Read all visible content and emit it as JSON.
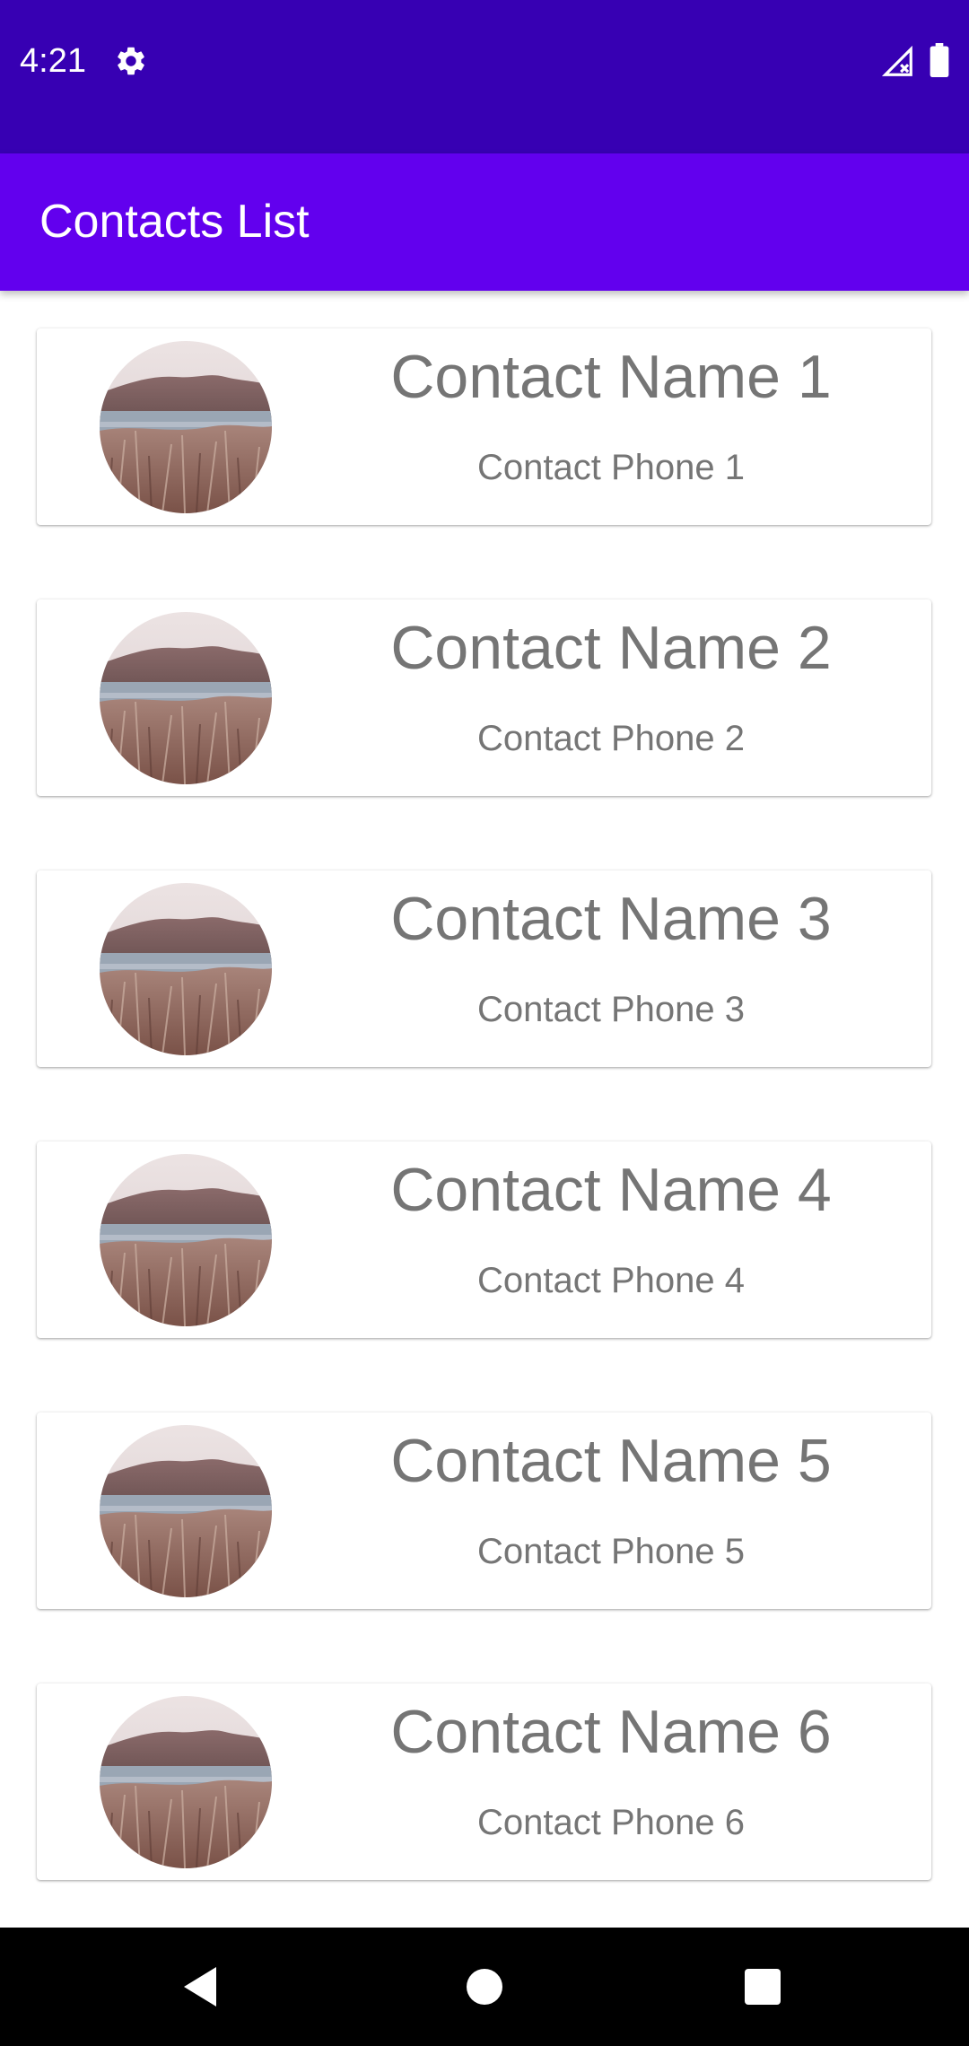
{
  "status_bar": {
    "time": "4:21",
    "settings_icon": "gear-icon",
    "signal_icon": "signal-off-icon",
    "battery_icon": "battery-full-icon",
    "color": "#3700b3"
  },
  "app_bar": {
    "title": "Contacts List",
    "color": "#6200ee"
  },
  "contacts": [
    {
      "name": "Contact Name 1",
      "phone": "Contact Phone 1",
      "avatar_icon": "landscape-photo"
    },
    {
      "name": "Contact Name 2",
      "phone": "Contact Phone 2",
      "avatar_icon": "landscape-photo"
    },
    {
      "name": "Contact Name 3",
      "phone": "Contact Phone 3",
      "avatar_icon": "landscape-photo"
    },
    {
      "name": "Contact Name 4",
      "phone": "Contact Phone 4",
      "avatar_icon": "landscape-photo"
    },
    {
      "name": "Contact Name 5",
      "phone": "Contact Phone 5",
      "avatar_icon": "landscape-photo"
    },
    {
      "name": "Contact Name 6",
      "phone": "Contact Phone 6",
      "avatar_icon": "landscape-photo"
    }
  ],
  "nav_bar": {
    "back_icon": "back-triangle-icon",
    "home_icon": "home-circle-icon",
    "recents_icon": "recents-square-icon"
  }
}
